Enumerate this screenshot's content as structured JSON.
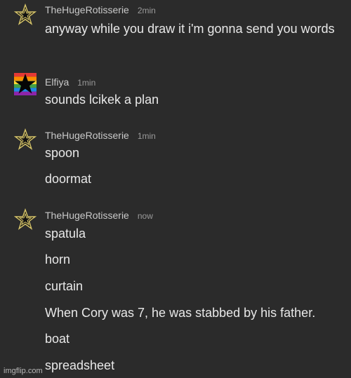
{
  "messages": [
    {
      "user": "TheHugeRotisserie",
      "time": "2min",
      "avatar_icon": "gold-star-icon",
      "lines": [
        "anyway while you draw it i'm gonna send you words"
      ]
    },
    {
      "user": "Elfiya",
      "time": "1min",
      "avatar_icon": "black-star-rainbow-icon",
      "lines": [
        "sounds lcikek a plan"
      ]
    },
    {
      "user": "TheHugeRotisserie",
      "time": "1min",
      "avatar_icon": "gold-star-icon",
      "lines": [
        "spoon",
        "doormat"
      ]
    },
    {
      "user": "TheHugeRotisserie",
      "time": "now",
      "avatar_icon": "gold-star-icon",
      "lines": [
        "spatula",
        "horn",
        "curtain",
        "When Cory was 7, he was stabbed by his father.",
        "boat",
        "spreadsheet"
      ]
    }
  ],
  "watermark": "imgflip.com",
  "colors": {
    "background": "#2b2b2b",
    "star_gold": "#d8c66a",
    "rainbow": [
      "#e53935",
      "#fb8c00",
      "#fdd835",
      "#43a047",
      "#1e88e5",
      "#8e24aa"
    ]
  }
}
